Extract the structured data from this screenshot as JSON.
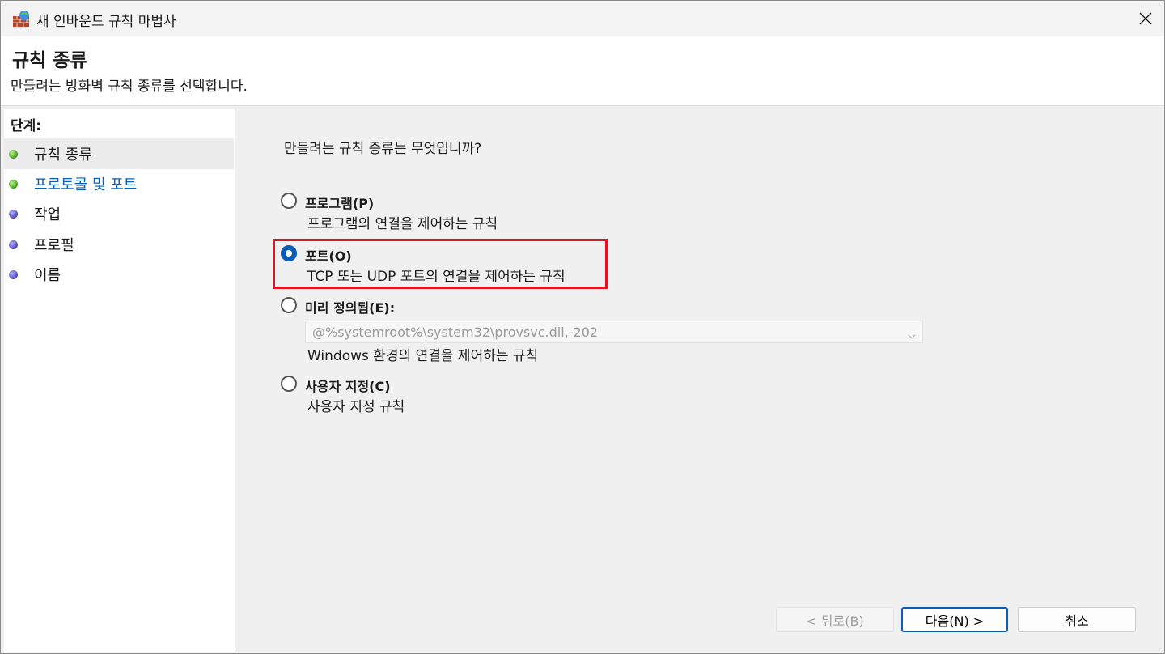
{
  "window": {
    "title": "새 인바운드 규칙 마법사",
    "icons": {
      "app": "firewall-icon",
      "close": "close-icon"
    }
  },
  "header": {
    "title": "규칙 종류",
    "subtitle": "만들려는 방화벽 규칙 종류를 선택합니다."
  },
  "steps": {
    "title": "단계:",
    "items": [
      {
        "label": "규칙 종류",
        "status": "green",
        "active": true
      },
      {
        "label": "프로토콜 및 포트",
        "status": "green",
        "link": true
      },
      {
        "label": "작업",
        "status": "blue"
      },
      {
        "label": "프로필",
        "status": "blue"
      },
      {
        "label": "이름",
        "status": "blue"
      }
    ]
  },
  "main": {
    "question": "만들려는 규칙 종류는 무엇입니까?",
    "options": [
      {
        "label": "프로그램(P)",
        "description": "프로그램의 연결을 제어하는 규칙",
        "checked": false
      },
      {
        "label": "포트(O)",
        "description": "TCP 또는 UDP 포트의 연결을 제어하는 규칙",
        "checked": true
      },
      {
        "label": "미리 정의됨(E):",
        "description": "Windows 환경의 연결을 제어하는 규칙",
        "checked": false,
        "combo_value": "@%systemroot%\\system32\\provsvc.dll,-202"
      },
      {
        "label": "사용자 지정(C)",
        "description": "사용자 지정 규칙",
        "checked": false
      }
    ],
    "highlight_color": "#e0151f"
  },
  "buttons": {
    "back": "< 뒤로(B)",
    "next": "다음(N) >",
    "cancel": "취소"
  },
  "colors": {
    "accent": "#0a5bb5",
    "link": "#0a60b8"
  }
}
